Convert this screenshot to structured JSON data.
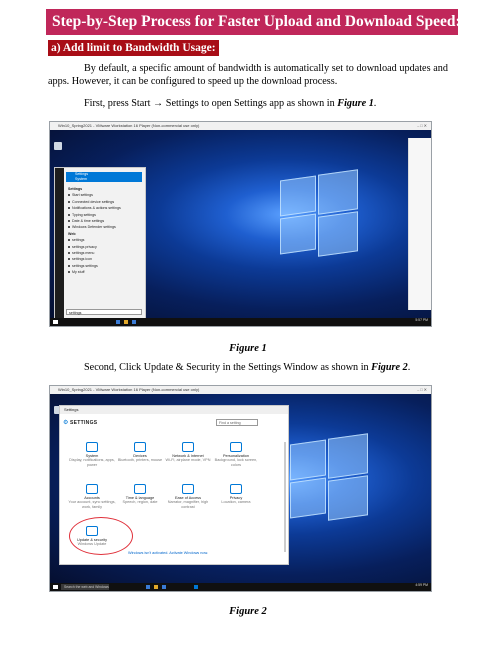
{
  "title": "Step-by-Step Process for Faster Upload and Download Speed:",
  "section": "a) Add limit to Bandwidth Usage:",
  "paragraphs": {
    "p1": "By default, a specific amount of bandwidth is automatically set to download updates and apps. However, it can be configured to speed up the download process.",
    "p2_text": "First, press Start → Settings to open Settings app as shown in ",
    "p2_ref": "Figure 1",
    "p2_end": ".",
    "p3_text": "Second, Click Update & Security in the Settings Window as shown in ",
    "p3_ref": "Figure 2",
    "p3_end": "."
  },
  "captions": {
    "fig1": "Figure 1",
    "fig2": "Figure 2"
  },
  "figure1": {
    "window_title": "Win10_Spring2021 - VMware Workstation 16 Player (Non-commercial use only)",
    "start_menu": {
      "best_match": "Settings",
      "best_match_sub": "System",
      "items": [
        {
          "label": "Settings",
          "header": true
        },
        {
          "label": "Start settings"
        },
        {
          "label": "Connected device settings"
        },
        {
          "label": "Notifications & actions settings"
        },
        {
          "label": "Typing settings"
        },
        {
          "label": "Date & time settings"
        },
        {
          "label": "Windows Defender settings"
        },
        {
          "label": "Web",
          "header": true
        },
        {
          "label": "settings"
        },
        {
          "label": "settings privacy"
        },
        {
          "label": "settings menu"
        },
        {
          "label": "settings icon"
        },
        {
          "label": "settings settings"
        },
        {
          "label": "My stuff"
        }
      ],
      "search_value": "settings"
    },
    "clock": "5:57 PM"
  },
  "figure2": {
    "window_title": "Win10_Spring2021 - VMware Workstation 16 Player (Non-commercial use only)",
    "settings_title": "Settings",
    "heading": "SETTINGS",
    "find_placeholder": "Find a setting",
    "tiles": [
      {
        "title": "System",
        "desc": "Display, notifications, apps, power"
      },
      {
        "title": "Devices",
        "desc": "Bluetooth, printers, mouse"
      },
      {
        "title": "Network & Internet",
        "desc": "Wi-Fi, airplane mode, VPN"
      },
      {
        "title": "Personalization",
        "desc": "Background, lock screen, colors"
      },
      {
        "title": "Accounts",
        "desc": "Your account, sync settings, work, family"
      },
      {
        "title": "Time & language",
        "desc": "Speech, region, date"
      },
      {
        "title": "Ease of Access",
        "desc": "Narrator, magnifier, high contrast"
      },
      {
        "title": "Privacy",
        "desc": "Location, camera"
      },
      {
        "title": "Update & security",
        "desc": "Windows Update"
      }
    ],
    "activation_link": "Windows isn't activated. Activate Windows now.",
    "search_placeholder": "Search the web and Windows",
    "clock": "4:59 PM"
  }
}
